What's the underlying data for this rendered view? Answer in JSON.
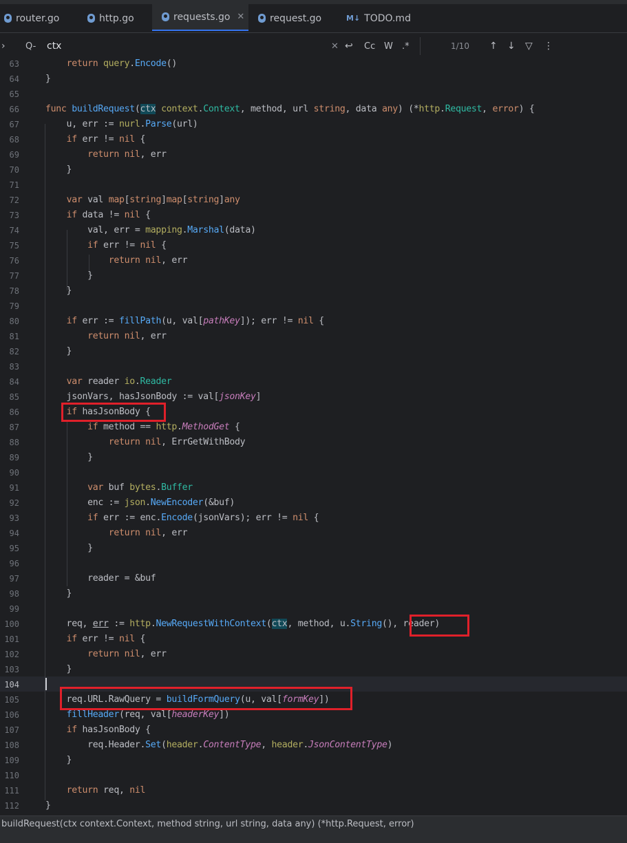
{
  "tabs": [
    {
      "label": "router.go",
      "icon": "gopher-icon"
    },
    {
      "label": "http.go",
      "icon": "gopher-icon"
    },
    {
      "label": "requests.go",
      "icon": "gopher-icon",
      "active": true
    },
    {
      "label": "request.go",
      "icon": "gopher-icon"
    },
    {
      "label": "TODO.md",
      "icon": "markdown-icon",
      "badge": "M↓"
    }
  ],
  "tab_close_glyph": "✕",
  "find": {
    "expand_glyph": "›",
    "search_glyph": "Q-",
    "query": "ctx",
    "clear_glyph": "✕",
    "wrap_glyph": "↩",
    "match_case": "Cc",
    "words": "W",
    "regex": ".*",
    "count": "1/10",
    "prev_glyph": "↑",
    "next_glyph": "↓",
    "filter_glyph": "▽",
    "more_glyph": "⋮"
  },
  "line_numbers": [
    "63",
    "64",
    "65",
    "66",
    "67",
    "68",
    "69",
    "70",
    "71",
    "72",
    "73",
    "74",
    "75",
    "76",
    "77",
    "78",
    "79",
    "80",
    "81",
    "82",
    "83",
    "84",
    "85",
    "86",
    "87",
    "88",
    "89",
    "90",
    "91",
    "92",
    "93",
    "94",
    "95",
    "96",
    "97",
    "98",
    "99",
    "100",
    "101",
    "102",
    "103",
    "104",
    "105",
    "106",
    "107",
    "108",
    "109",
    "110",
    "111",
    "112"
  ],
  "code": [
    "    return query.Encode()",
    "}",
    "",
    "func buildRequest(ctx context.Context, method, url string, data any) (*http.Request, error) {",
    "    u, err := nurl.Parse(url)",
    "    if err != nil {",
    "        return nil, err",
    "    }",
    "",
    "    var val map[string]map[string]any",
    "    if data != nil {",
    "        val, err = mapping.Marshal(data)",
    "        if err != nil {",
    "            return nil, err",
    "        }",
    "    }",
    "",
    "    if err := fillPath(u, val[pathKey]); err != nil {",
    "        return nil, err",
    "    }",
    "",
    "    var reader io.Reader",
    "    jsonVars, hasJsonBody := val[jsonKey]",
    "    if hasJsonBody {",
    "        if method == http.MethodGet {",
    "            return nil, ErrGetWithBody",
    "        }",
    "",
    "        var buf bytes.Buffer",
    "        enc := json.NewEncoder(&buf)",
    "        if err := enc.Encode(jsonVars); err != nil {",
    "            return nil, err",
    "        }",
    "",
    "        reader = &buf",
    "    }",
    "",
    "    req, err := http.NewRequestWithContext(ctx, method, u.String(), reader)",
    "    if err != nil {",
    "        return nil, err",
    "    }",
    "",
    "    req.URL.RawQuery = buildFormQuery(u, val[formKey])",
    "    fillHeader(req, val[headerKey])",
    "    if hasJsonBody {",
    "        req.Header.Set(header.ContentType, header.JsonContentType)",
    "    }",
    "",
    "    return req, nil",
    "}"
  ],
  "status": {
    "signature": "buildRequest(ctx context.Context, method string, url string, data any) (*http.Request, error)"
  },
  "colors": {
    "background": "#1e1f22",
    "keyword": "#cf8e6d",
    "function": "#56a8f5",
    "package": "#b3ae60",
    "type": "#2fbaa3",
    "field": "#c77dbb",
    "annotation_box": "#e0202a",
    "active_tab_underline": "#3574f0"
  }
}
